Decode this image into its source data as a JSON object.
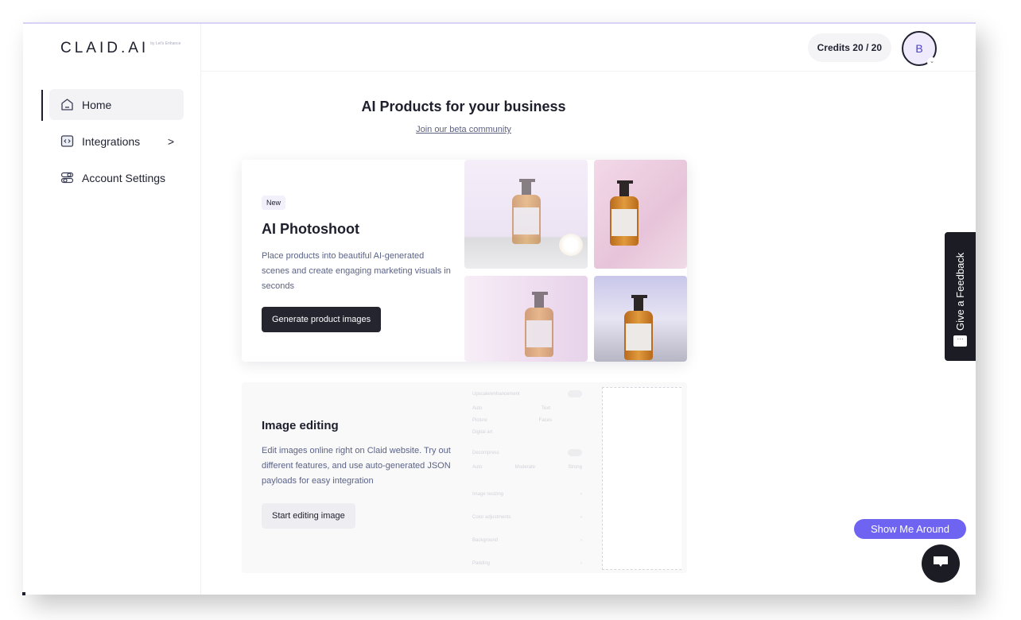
{
  "brand": {
    "logo": "CLAID.AI",
    "logo_sub": "by Let's Enhance"
  },
  "sidebar": {
    "items": [
      {
        "label": "Home",
        "icon": "home-icon",
        "active": true
      },
      {
        "label": "Integrations",
        "icon": "code-icon",
        "chevron": ">"
      },
      {
        "label": "Account Settings",
        "icon": "settings-toggles-icon"
      }
    ]
  },
  "topbar": {
    "credits": "Credits 20 / 20",
    "avatar_initial": "B",
    "avatar_chevron": "⌄"
  },
  "main": {
    "title": "AI Products for your business",
    "beta_link": "Join our beta community",
    "cards": [
      {
        "badge": "New",
        "title": "AI Photoshoot",
        "description": "Place products into beautiful AI-generated scenes and create engaging marketing visuals in seconds",
        "button": "Generate product images"
      },
      {
        "title": "Image editing",
        "description": "Edit images online right on Claid website. Try out different features, and use auto-generated JSON payloads for easy integration",
        "button": "Start editing image",
        "preview": {
          "rows": [
            {
              "label": "Upscale/enhancement"
            },
            {
              "label": "Auto",
              "value": "Text"
            },
            {
              "label": "Picture",
              "value": "Faces"
            },
            {
              "label": "Digital art"
            },
            {
              "label": "Decompress"
            },
            {
              "label": "Auto",
              "value": "Moderate",
              "value2": "Strong"
            },
            {
              "label": "Image resizing",
              "chevron": "›"
            },
            {
              "label": "Color adjustments",
              "chevron": "›"
            },
            {
              "label": "Background",
              "chevron": "›"
            },
            {
              "label": "Padding",
              "chevron": "›"
            }
          ]
        }
      }
    ]
  },
  "widgets": {
    "feedback": "Give a Feedback",
    "feedback_icon_text": "···",
    "show_around": "Show Me Around"
  }
}
